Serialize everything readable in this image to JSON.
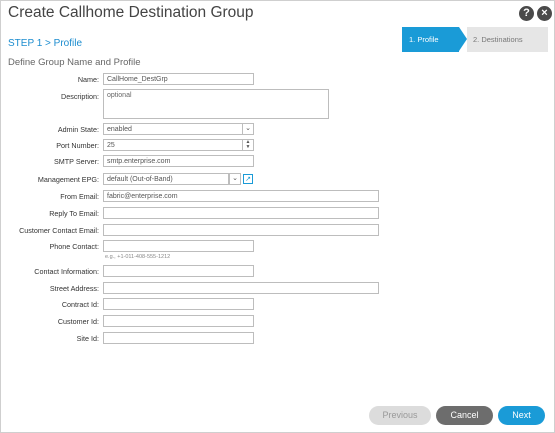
{
  "dialog": {
    "title": "Create Callhome Destination Group",
    "help_icon": "?",
    "close_icon": "×"
  },
  "step_label": "STEP 1 > Profile",
  "wizard": {
    "steps": [
      {
        "label": "1. Profile",
        "active": true
      },
      {
        "label": "2. Destinations",
        "active": false
      }
    ]
  },
  "subtitle": "Define Group Name and Profile",
  "form": {
    "name": {
      "label": "Name:",
      "value": "CallHome_DestGrp"
    },
    "description": {
      "label": "Description:",
      "placeholder": "optional"
    },
    "admin_state": {
      "label": "Admin State:",
      "value": "enabled"
    },
    "port_number": {
      "label": "Port Number:",
      "value": "25"
    },
    "smtp_server": {
      "label": "SMTP Server:",
      "value": "smtp.enterprise.com"
    },
    "management_epg": {
      "label": "Management EPG:",
      "value": "default (Out-of-Band)"
    },
    "from_email": {
      "label": "From Email:",
      "value": "fabric@enterprise.com"
    },
    "reply_to_email": {
      "label": "Reply To Email:",
      "value": ""
    },
    "customer_contact_email": {
      "label": "Customer Contact Email:",
      "value": ""
    },
    "phone_contact": {
      "label": "Phone Contact:",
      "value": "",
      "hint": "e.g., +1-011-408-555-1212"
    },
    "contact_information": {
      "label": "Contact Information:",
      "value": ""
    },
    "street_address": {
      "label": "Street Address:",
      "value": ""
    },
    "contract_id": {
      "label": "Contract Id:",
      "value": ""
    },
    "customer_id": {
      "label": "Customer Id:",
      "value": ""
    },
    "site_id": {
      "label": "Site Id:",
      "value": ""
    }
  },
  "buttons": {
    "previous": "Previous",
    "cancel": "Cancel",
    "next": "Next"
  },
  "colors": {
    "accent": "#1a9bd7",
    "cancel": "#6d6d6d",
    "disabled": "#dcdcdc"
  },
  "icons": {
    "dropdown": "chevron-down-icon",
    "spinner": "spinner-arrows-icon",
    "epg_link": "open-link-icon"
  }
}
